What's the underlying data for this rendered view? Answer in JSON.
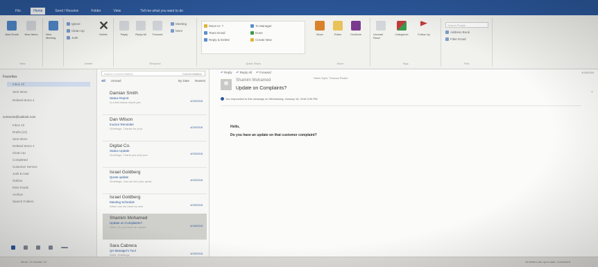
{
  "app": {
    "accent": "#2b579a"
  },
  "tabs": [
    "File",
    "Home",
    "Send / Receive",
    "Folder",
    "View"
  ],
  "tell_me": "Tell me what you want to do",
  "ribbon": {
    "groups": {
      "new_label": "New",
      "delete_label": "Delete",
      "respond_label": "Respond",
      "quick_steps_label": "Quick Steps",
      "move_label": "Move",
      "tags_label": "Tags",
      "find_label": "Find"
    },
    "buttons": {
      "new_email": "New Email",
      "new_items": "New Items",
      "new_meeting": "New Meeting",
      "ignore": "Ignore",
      "clean_up": "Clean Up",
      "junk": "Junk",
      "delete": "Delete",
      "reply": "Reply",
      "reply_all": "Reply All",
      "forward": "Forward",
      "meeting": "Meeting",
      "more": "More",
      "move": "Move",
      "rules": "Rules",
      "onenote": "OneNote",
      "unread_read": "Unread/ Read",
      "categorize": "Categorize",
      "follow_up": "Follow Up",
      "address_book": "Address Book",
      "filter_email": "Filter Email"
    },
    "quick_steps": [
      "Move to: ?",
      "Team Email",
      "Reply & Delete",
      "To Manager",
      "Done",
      "Create New"
    ],
    "search_people_placeholder": "Search People"
  },
  "folders": {
    "favorites_label": "Favorites",
    "favorites": [
      "Inbox 10",
      "Sent Items",
      "Deleted Items 4"
    ],
    "account": "someone@outlook.com",
    "account_folders": [
      "Inbox 10",
      "Drafts [10]",
      "Sent Items",
      "Deleted Items 4",
      "Clean Up",
      "Completed",
      "Customer Service",
      "Junk E-mail",
      "Outbox",
      "RSS Feeds",
      "Archive",
      "Search Folders"
    ]
  },
  "message_list": {
    "search_placeholder": "Search Current Mailbox",
    "scope": "Current Mailbox",
    "filter_all": "All",
    "filter_unread": "Unread",
    "sort": "By Date",
    "order": "Newest",
    "messages": [
      {
        "from": "Damian Smith",
        "subject": "Status Report",
        "preview": "Is a first status report yes",
        "date": "4/20/2018"
      },
      {
        "from": "Dan Wilson",
        "subject": "Invoice Reminder",
        "preview": "Greetings, Thanks for your",
        "date": "4/20/2018"
      },
      {
        "from": "Digital Co.",
        "subject": "Status Update",
        "preview": "Greetings, Thank you and your",
        "date": "4/20/2018"
      },
      {
        "from": "Israel Goldberg",
        "subject": "Quote update",
        "preview": "Greetings, Can we see your quote",
        "date": "4/20/2018"
      },
      {
        "from": "Israel Goldberg",
        "subject": "Meeting Schedule",
        "preview": "When can we meet by next",
        "date": "4/20/2018"
      },
      {
        "from": "Shamim Mohamed",
        "subject": "Update on Complaints?",
        "preview": "Hello, Do you have an update",
        "date": "4/18/2018"
      },
      {
        "from": "Sara Cabrera",
        "subject": "QA Manager's Tool",
        "preview": "Hello, Greetings",
        "date": "4/20/2018"
      }
    ]
  },
  "reading": {
    "actions": [
      "Reply",
      "Reply All",
      "Forward"
    ],
    "date": "4/18/2018",
    "from": "Shamim Mohamed",
    "to": "Helen Dyer; Thomas Parker",
    "subject": "Update on Complaints?",
    "info": "You responded to this message on Wednesday, January 18, 2018 3:05 PM.",
    "body_greeting": "Hello,",
    "body_text": "Do you have an update on that customer complaint?"
  },
  "status": {
    "left": "Items: 11   Unread: 10",
    "right": "All folders are up to date.   Connected"
  }
}
